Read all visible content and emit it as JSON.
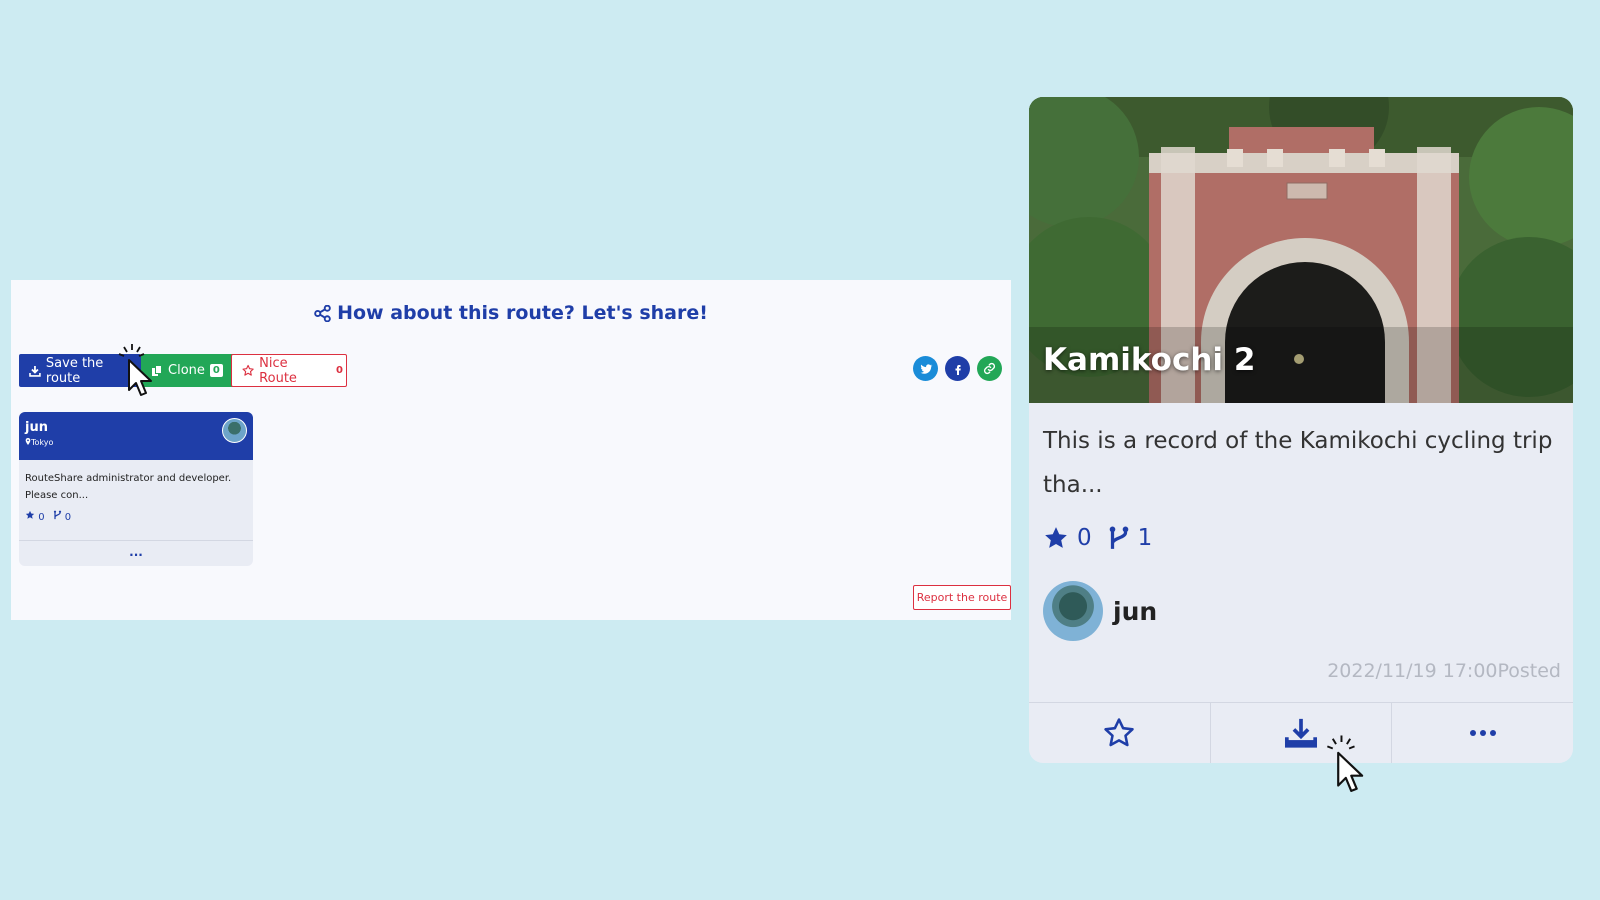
{
  "share_panel": {
    "heading": "How about this route? Let's share!",
    "save_label": "Save the route",
    "clone_label": "Clone",
    "clone_count": "0",
    "nice_label": "Nice Route",
    "nice_count": "0",
    "report_label": "Report the route"
  },
  "user_card": {
    "name": "jun",
    "location": "Tokyo",
    "bio_line1": "RouteShare administrator and developer.",
    "bio_line2": "Please con...",
    "stars": "0",
    "forks": "0",
    "more": "..."
  },
  "route_card": {
    "title": "Kamikochi 2",
    "description": "This is a record of the Kamikochi cycling trip tha...",
    "stars": "0",
    "forks": "1",
    "author": "jun",
    "posted": "2022/11/19 17:00Posted"
  },
  "colors": {
    "background": "#cdebf2",
    "primary": "#1f3ea8",
    "clone_green": "#22a757",
    "nice_red": "#dc3040"
  },
  "icons": [
    "share-icon",
    "download-icon",
    "clone-icon",
    "star-icon",
    "twitter-icon",
    "facebook-icon",
    "link-icon",
    "location-icon",
    "fork-icon",
    "more-icon",
    "cursor-icon"
  ]
}
